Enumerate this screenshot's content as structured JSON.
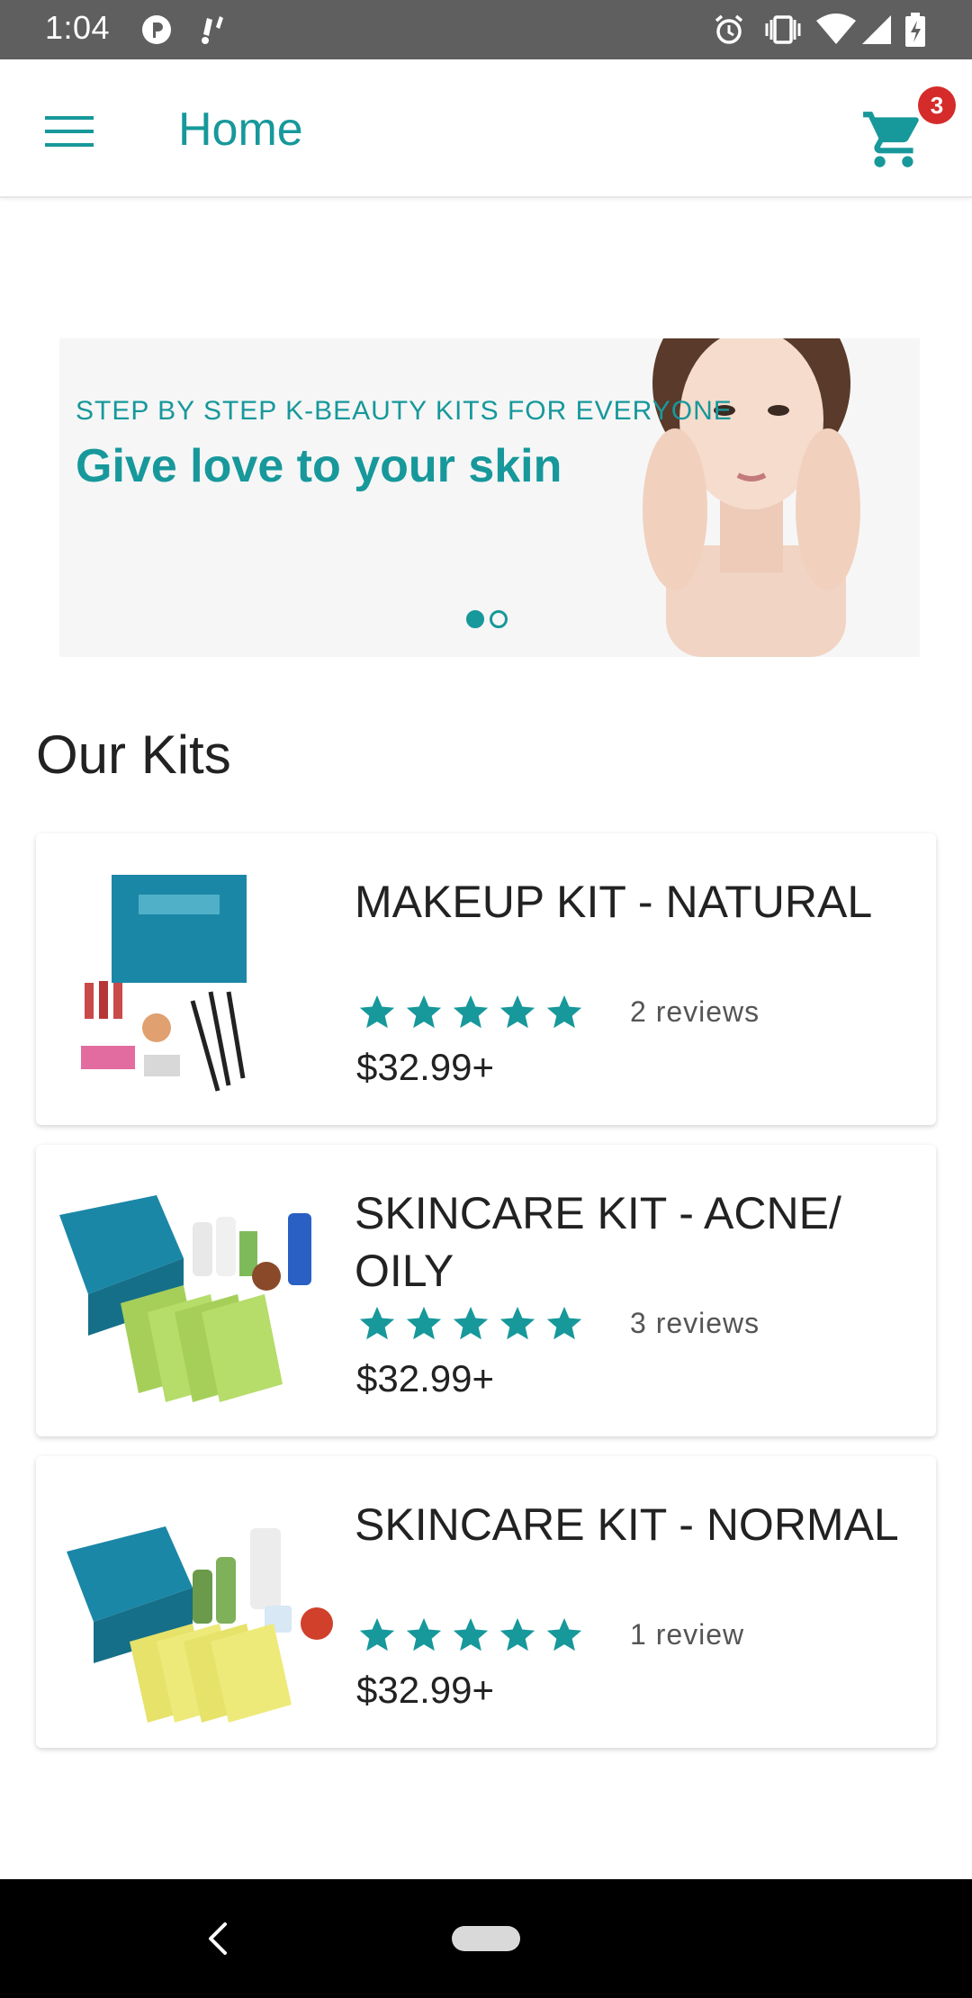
{
  "status_bar": {
    "time": "1:04",
    "icons": [
      "p-icon",
      "notification-icon",
      "alarm-icon",
      "vibrate-icon",
      "wifi-icon",
      "signal-icon",
      "battery-charging-icon"
    ]
  },
  "app_bar": {
    "title": "Home",
    "cart_count": "3",
    "accent_color": "#17989b"
  },
  "banner": {
    "subtitle": "STEP BY STEP K-BEAUTY KITS FOR EVERYONE",
    "title": "Give love to your skin",
    "slide_count": 2,
    "active_slide": 1
  },
  "section": {
    "title": "Our Kits"
  },
  "products": [
    {
      "name": "MAKEUP KIT - NATURAL",
      "rating": 5,
      "reviews": "2 reviews",
      "price": "$32.99+"
    },
    {
      "name": "SKINCARE KIT - ACNE/ OILY",
      "rating": 5,
      "reviews": "3 reviews",
      "price": "$32.99+"
    },
    {
      "name": "SKINCARE KIT - NORMAL",
      "rating": 5,
      "reviews": "1 review",
      "price": "$32.99+"
    }
  ],
  "nav_bar": {
    "icons": [
      "back-icon",
      "home-pill-icon"
    ]
  }
}
